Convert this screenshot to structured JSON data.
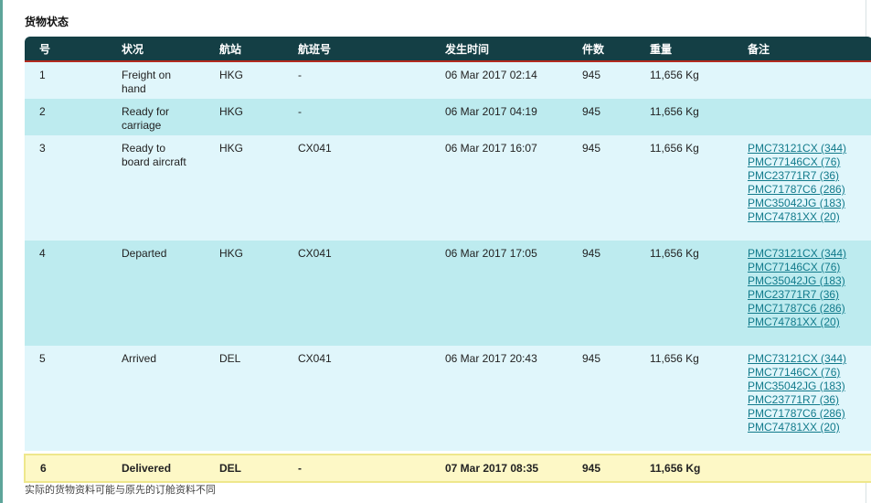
{
  "title": "货物状态",
  "headers": [
    "号",
    "状况",
    "航站",
    "航班号",
    "发生时间",
    "件数",
    "重量",
    "备注"
  ],
  "rows": [
    {
      "no": "1",
      "status_l1": "Freight on",
      "status_l2": "hand",
      "station": "HKG",
      "flight": "-",
      "time": "06 Mar 2017  02:14",
      "pieces": "945",
      "weight": "11,656 Kg",
      "remarks": []
    },
    {
      "no": "2",
      "status_l1": "Ready for",
      "status_l2": "carriage",
      "station": "HKG",
      "flight": "-",
      "time": "06 Mar 2017  04:19",
      "pieces": "945",
      "weight": "11,656 Kg",
      "remarks": []
    },
    {
      "no": "3",
      "status_l1": "Ready to",
      "status_l2": "board aircraft",
      "station": "HKG",
      "flight": "CX041",
      "time": "06 Mar 2017  16:07",
      "pieces": "945",
      "weight": "11,656 Kg",
      "remarks": [
        "PMC73121CX (344)",
        "PMC77146CX (76)",
        "PMC23771R7 (36)",
        "PMC71787C6 (286)",
        "PMC35042JG (183)",
        "PMC74781XX (20)"
      ]
    },
    {
      "no": "4",
      "status_l1": "Departed",
      "status_l2": "",
      "station": "HKG",
      "flight": "CX041",
      "time": "06 Mar 2017  17:05",
      "pieces": "945",
      "weight": "11,656 Kg",
      "remarks": [
        "PMC73121CX (344)",
        "PMC77146CX (76)",
        "PMC35042JG (183)",
        "PMC23771R7 (36)",
        "PMC71787C6 (286)",
        "PMC74781XX (20)"
      ]
    },
    {
      "no": "5",
      "status_l1": "Arrived",
      "status_l2": "",
      "station": "DEL",
      "flight": "CX041",
      "time": "06 Mar 2017  20:43",
      "pieces": "945",
      "weight": "11,656 Kg",
      "remarks": [
        "PMC73121CX (344)",
        "PMC77146CX (76)",
        "PMC35042JG (183)",
        "PMC23771R7 (36)",
        "PMC71787C6 (286)",
        "PMC74781XX (20)"
      ]
    },
    {
      "no": "6",
      "status_l1": "Delivered",
      "status_l2": "",
      "station": "DEL",
      "flight": "-",
      "time": "07 Mar 2017  08:35",
      "pieces": "945",
      "weight": "11,656 Kg",
      "remarks": []
    }
  ],
  "footnote": "实际的货物资料可能与原先的订舱资料不同",
  "colors": {
    "header_bg": "#143f45",
    "header_rule": "#b22a1e",
    "row_light": "#e0f6fb",
    "row_dark": "#bdebef",
    "highlight_row": "#fdf8c6",
    "link": "#117a8b"
  },
  "icons": []
}
